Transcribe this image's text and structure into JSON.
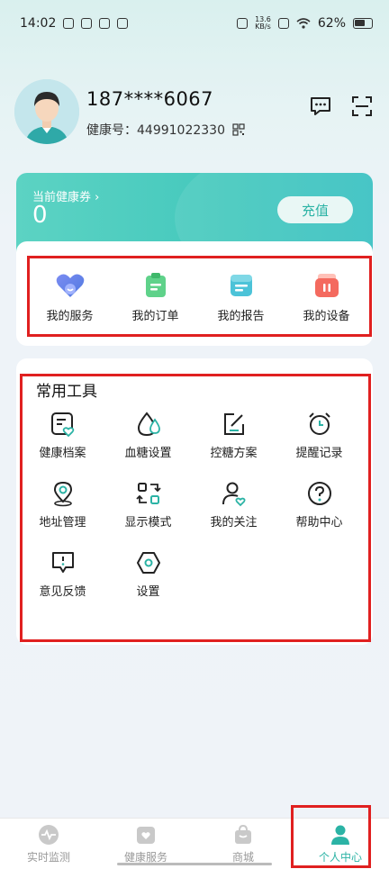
{
  "status_bar": {
    "time": "14:02",
    "network_speed_top": "13.6",
    "network_speed_bottom": "KB/s",
    "battery": "62%"
  },
  "profile": {
    "phone": "187****6067",
    "health_id_label": "健康号：",
    "health_id_value": "44991022330"
  },
  "coupon": {
    "label": "当前健康券 ›",
    "value": "0",
    "recharge_label": "充值"
  },
  "services": [
    {
      "label": "我的服务",
      "icon": "heart-service-icon"
    },
    {
      "label": "我的订单",
      "icon": "clipboard-order-icon"
    },
    {
      "label": "我的报告",
      "icon": "report-icon"
    },
    {
      "label": "我的设备",
      "icon": "device-icon"
    }
  ],
  "tools": {
    "title": "常用工具",
    "items": [
      {
        "label": "健康档案",
        "icon": "health-record-icon"
      },
      {
        "label": "血糖设置",
        "icon": "blood-drop-icon"
      },
      {
        "label": "控糖方案",
        "icon": "edit-plan-icon"
      },
      {
        "label": "提醒记录",
        "icon": "alarm-clock-icon"
      },
      {
        "label": "地址管理",
        "icon": "location-pin-icon"
      },
      {
        "label": "显示模式",
        "icon": "display-mode-icon"
      },
      {
        "label": "我的关注",
        "icon": "follow-user-icon"
      },
      {
        "label": "帮助中心",
        "icon": "help-icon"
      },
      {
        "label": "意见反馈",
        "icon": "feedback-icon"
      },
      {
        "label": "设置",
        "icon": "settings-hexagon-icon"
      }
    ]
  },
  "bottom_nav": [
    {
      "label": "实时监测",
      "icon": "pulse-icon",
      "active": false
    },
    {
      "label": "健康服务",
      "icon": "health-service-icon",
      "active": false
    },
    {
      "label": "商城",
      "icon": "shopping-bag-icon",
      "active": false
    },
    {
      "label": "个人中心",
      "icon": "person-icon",
      "active": true
    }
  ],
  "colors": {
    "accent": "#2bb3a5",
    "highlight_box": "#e02020"
  }
}
